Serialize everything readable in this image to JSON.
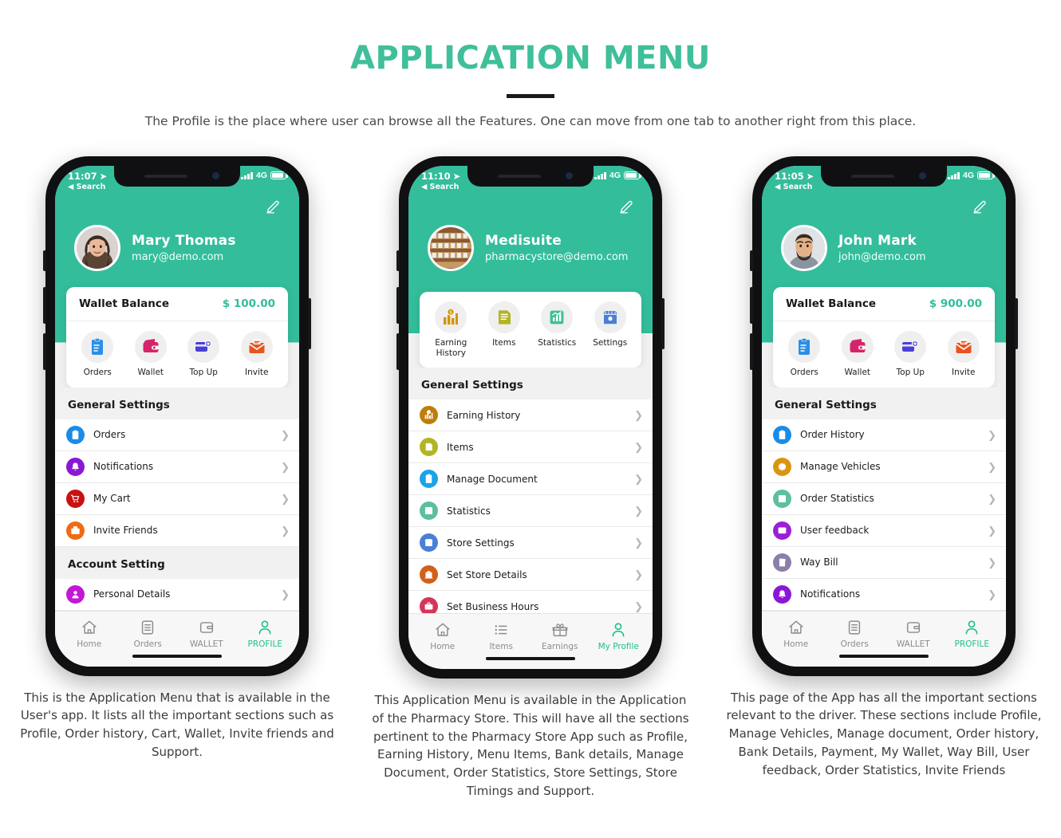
{
  "header": {
    "title": "APPLICATION MENU",
    "subtitle": "The Profile is the place where user can browse all the Features. One can move from one tab to another right from this place."
  },
  "theme": {
    "accent": "#33bd9b",
    "title_color": "#3fbf9a",
    "tab_active": "#1fbf8f"
  },
  "phones": [
    {
      "status": {
        "time": "11:07",
        "back": "Search",
        "network": "4G"
      },
      "profile": {
        "name": "Mary Thomas",
        "email": "mary@demo.com",
        "avatar": "woman-avatar"
      },
      "wallet": {
        "label": "Wallet Balance",
        "value": "$ 100.00",
        "show": true
      },
      "quick_actions": [
        {
          "label": "Orders",
          "icon": "clipboard-check-icon",
          "color": "#2b8ee8"
        },
        {
          "label": "Wallet",
          "icon": "wallet-icon",
          "color": "#d6246a"
        },
        {
          "label": "Top Up",
          "icon": "topup-card-icon",
          "color": "#4a3fd4"
        },
        {
          "label": "Invite",
          "icon": "envelope-invite-icon",
          "color": "#e8531f"
        }
      ],
      "sections": [
        {
          "title": "General Settings",
          "items": [
            {
              "label": "Orders",
              "icon": "clipboard-check-icon",
              "color": "#1a8ce8"
            },
            {
              "label": "Notifications",
              "icon": "bell-icon",
              "color": "#8b17d6"
            },
            {
              "label": "My Cart",
              "icon": "cart-icon",
              "color": "#c81111"
            },
            {
              "label": "Invite Friends",
              "icon": "envelope-invite-icon",
              "color": "#ef6a14"
            }
          ]
        },
        {
          "title": "Account Setting",
          "items": [
            {
              "label": "Personal Details",
              "icon": "person-icon",
              "color": "#c316d6"
            }
          ]
        }
      ],
      "tabs": [
        {
          "label": "Home",
          "icon": "home-icon",
          "active": false
        },
        {
          "label": "Orders",
          "icon": "document-icon",
          "active": false
        },
        {
          "label": "WALLET",
          "icon": "wallet-outline-icon",
          "active": false
        },
        {
          "label": "PROFILE",
          "icon": "person-outline-icon",
          "active": true
        }
      ],
      "caption": "This is the Application Menu that is available in the User's app. It lists all the important sections such as Profile, Order history, Cart, Wallet, Invite friends and Support."
    },
    {
      "status": {
        "time": "11:10",
        "back": "Search",
        "network": "4G"
      },
      "profile": {
        "name": "Medisuite",
        "email": "pharmacystore@demo.com",
        "avatar": "store-avatar"
      },
      "wallet": {
        "label": "",
        "value": "",
        "show": false
      },
      "quick_actions": [
        {
          "label": "Earning History",
          "icon": "earnings-icon",
          "color": "#d39400"
        },
        {
          "label": "Items",
          "icon": "list-doc-icon",
          "color": "#b2b522"
        },
        {
          "label": "Statistics",
          "icon": "chart-up-icon",
          "color": "#3ebf94"
        },
        {
          "label": "Settings",
          "icon": "store-icon",
          "color": "#4a7fd6"
        }
      ],
      "sections": [
        {
          "title": "General Settings",
          "items": [
            {
              "label": "Earning History",
              "icon": "earnings-icon",
              "color": "#c07d0c"
            },
            {
              "label": "Items",
              "icon": "list-doc-icon",
              "color": "#b2b522"
            },
            {
              "label": "Manage Document",
              "icon": "clipboard-check-icon",
              "color": "#1aa3e8"
            },
            {
              "label": "Statistics",
              "icon": "chart-up-icon",
              "color": "#5cbf9d"
            },
            {
              "label": "Store Settings",
              "icon": "store-icon",
              "color": "#4a7fd6"
            },
            {
              "label": "Set Store Details",
              "icon": "store-front-icon",
              "color": "#d2601a"
            },
            {
              "label": "Set Business Hours",
              "icon": "briefcase-icon",
              "color": "#d6355a"
            }
          ]
        }
      ],
      "tabs": [
        {
          "label": "Home",
          "icon": "home-icon",
          "active": false
        },
        {
          "label": "Items",
          "icon": "list-icon",
          "active": false
        },
        {
          "label": "Earnings",
          "icon": "gift-icon",
          "active": false
        },
        {
          "label": "My Profile",
          "icon": "person-outline-icon",
          "active": true
        }
      ],
      "caption": "This Application Menu is available in the Application of the Pharmacy Store. This will have all the sections pertinent to the Pharmacy Store App such as Profile, Earning History, Menu Items, Bank details, Manage Document, Order Statistics, Store Settings, Store Timings and Support."
    },
    {
      "status": {
        "time": "11:05",
        "back": "Search",
        "network": "4G"
      },
      "profile": {
        "name": "John Mark",
        "email": "john@demo.com",
        "avatar": "man-avatar"
      },
      "wallet": {
        "label": "Wallet Balance",
        "value": "$ 900.00",
        "show": true
      },
      "quick_actions": [
        {
          "label": "Orders",
          "icon": "clipboard-check-icon",
          "color": "#2b8ee8"
        },
        {
          "label": "Wallet",
          "icon": "wallet-icon",
          "color": "#d6246a"
        },
        {
          "label": "Top Up",
          "icon": "topup-card-icon",
          "color": "#4a3fd4"
        },
        {
          "label": "Invite",
          "icon": "envelope-invite-icon",
          "color": "#e8531f"
        }
      ],
      "sections": [
        {
          "title": "General Settings",
          "items": [
            {
              "label": "Order History",
              "icon": "clipboard-check-icon",
              "color": "#1a8ce8"
            },
            {
              "label": "Manage Vehicles",
              "icon": "gear-icon",
              "color": "#d99512"
            },
            {
              "label": "Order Statistics",
              "icon": "chart-up-icon",
              "color": "#5cbf9d"
            },
            {
              "label": "User feedback",
              "icon": "feedback-icon",
              "color": "#9a1fd6"
            },
            {
              "label": "Way Bill",
              "icon": "waybill-icon",
              "color": "#8b7fa8"
            },
            {
              "label": "Notifications",
              "icon": "bell-icon",
              "color": "#8b17d6"
            }
          ]
        }
      ],
      "tabs": [
        {
          "label": "Home",
          "icon": "home-icon",
          "active": false
        },
        {
          "label": "Orders",
          "icon": "document-icon",
          "active": false
        },
        {
          "label": "WALLET",
          "icon": "wallet-outline-icon",
          "active": false
        },
        {
          "label": "PROFILE",
          "icon": "person-outline-icon",
          "active": true
        }
      ],
      "caption": "This page of the App has all the important sections relevant to the driver. These sections include Profile, Manage Vehicles, Manage document, Order history, Bank Details, Payment, My Wallet, Way Bill, User feedback, Order Statistics, Invite Friends"
    }
  ]
}
